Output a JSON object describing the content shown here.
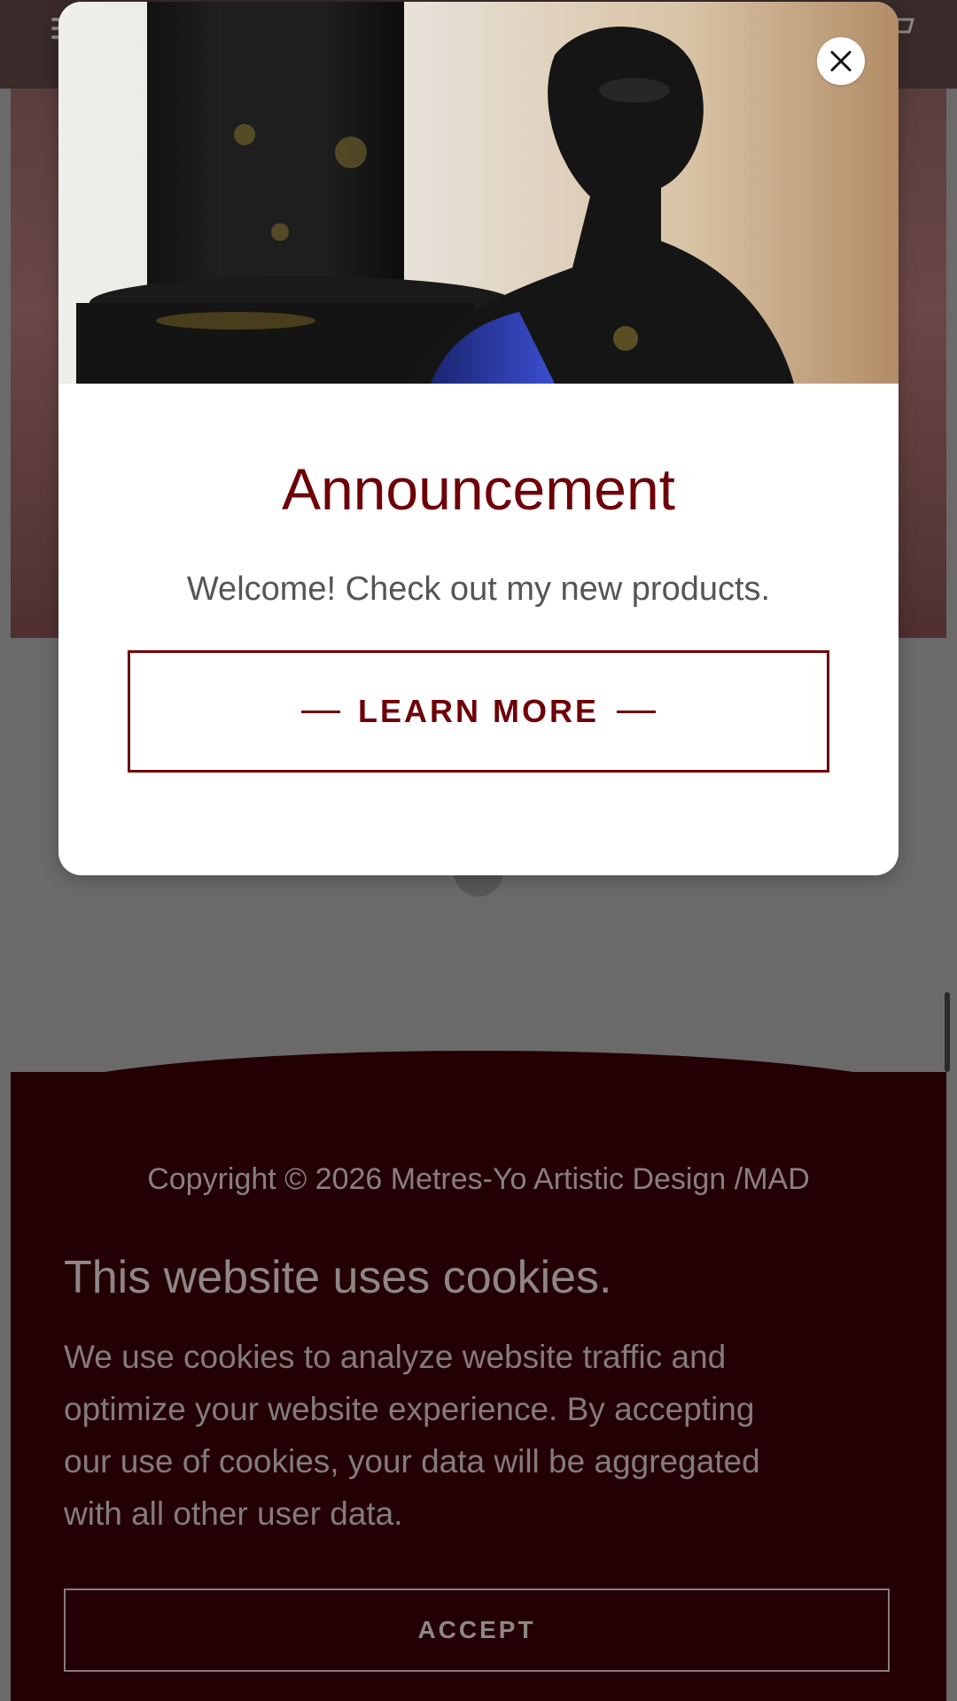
{
  "modal": {
    "title": "Announcement",
    "message": "Welcome! Check out my new products.",
    "button_label": "LEARN MORE",
    "image_icon": "sculpture-photo",
    "close_icon": "close-icon"
  },
  "footer": {
    "copyright": "Copyright © 2026 Metres-Yo Artistic Design /MAD"
  },
  "cookie_banner": {
    "title": "This website uses cookies.",
    "text": "We use cookies to analyze website traffic and optimize your website experience. By accepting our use of cookies, your data will be aggregated with all other user data.",
    "accept_label": "ACCEPT"
  },
  "header": {
    "menu_icon": "hamburger-menu-icon",
    "cart_icon": "cart-icon"
  },
  "colors": {
    "brand": "#6e0008",
    "footer_bg": "#230003",
    "overlay": "#5f5f5f"
  }
}
